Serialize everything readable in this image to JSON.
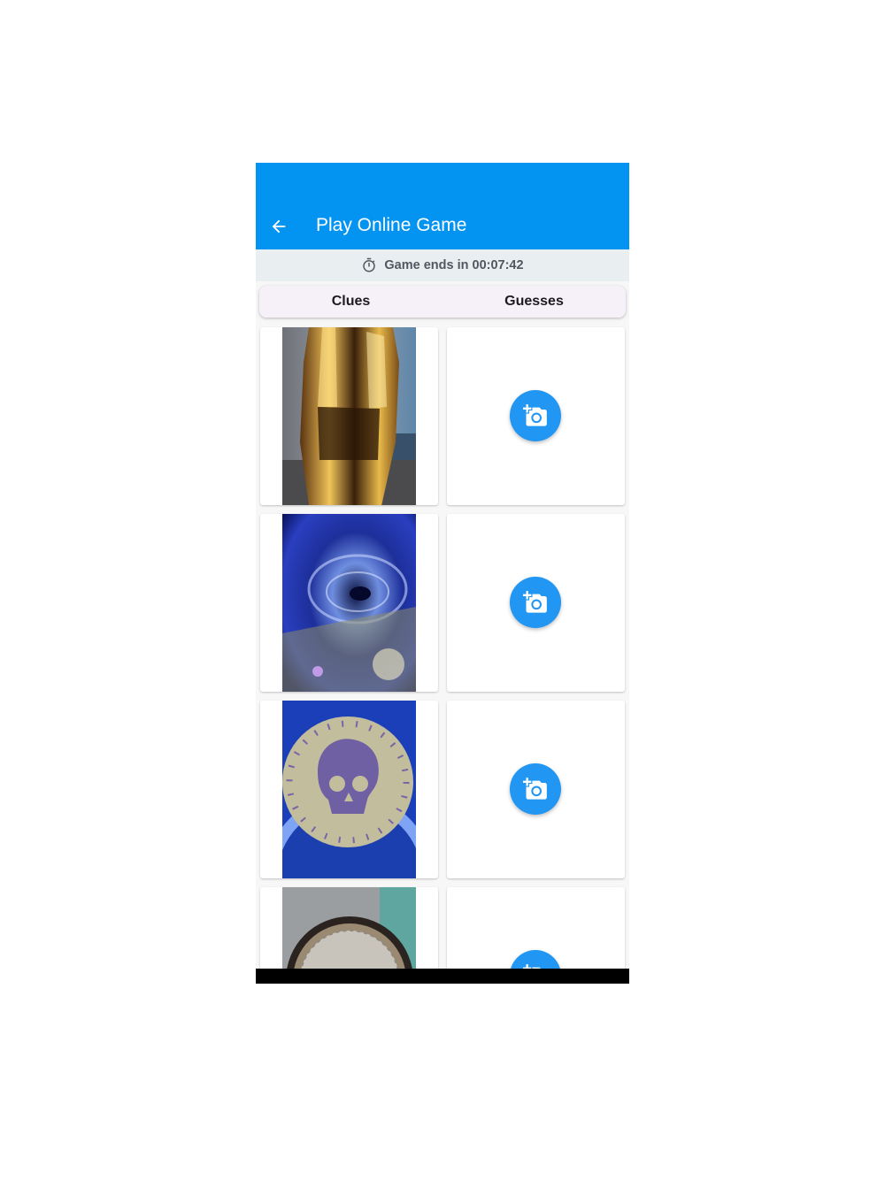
{
  "app_bar": {
    "title": "Play Online Game",
    "back_icon": "arrow-back-icon",
    "color": "#0393f0"
  },
  "timer": {
    "icon": "stopwatch-icon",
    "text": "Game ends in 00:07:42"
  },
  "tabs": [
    {
      "label": "Clues"
    },
    {
      "label": "Guesses"
    }
  ],
  "rows": [
    {
      "clue_image": "golden faceted vase photo",
      "guess_action_icon": "add-photo-camera-icon"
    },
    {
      "clue_image": "blue swirling galaxy photo",
      "guess_action_icon": "add-photo-camera-icon"
    },
    {
      "clue_image": "skull coin emblem photo",
      "guess_action_icon": "add-photo-camera-icon"
    },
    {
      "clue_image": "car headlight photo",
      "guess_action_icon": "add-photo-camera-icon"
    }
  ],
  "colors": {
    "fab": "#2196f3",
    "timer_background": "#e9eef1"
  }
}
